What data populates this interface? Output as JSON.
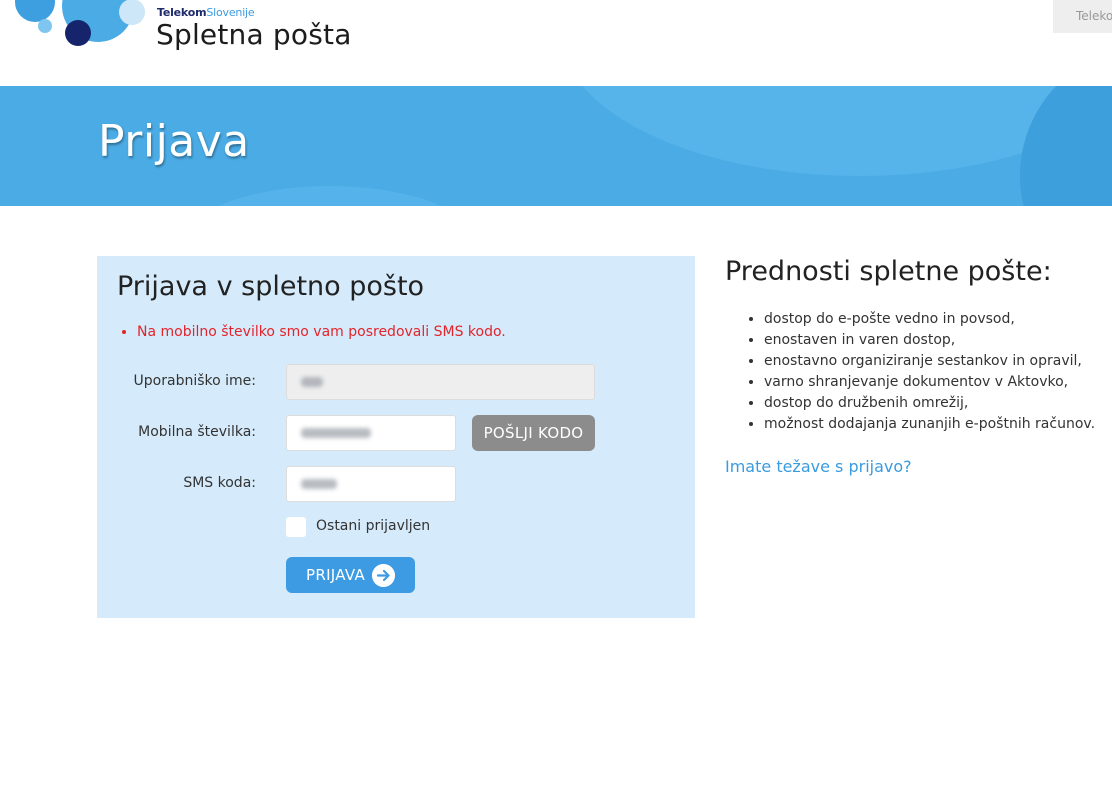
{
  "header": {
    "brand_primary": "Telekom",
    "brand_secondary": "Slovenije",
    "product_name": "Spletna pošta",
    "top_tab_label": "Telekom"
  },
  "banner": {
    "title": "Prijava"
  },
  "login_form": {
    "title": "Prijava v spletno pošto",
    "error_message": "Na mobilno številko smo vam posredovali SMS kodo.",
    "username_label": "Uporabniško ime:",
    "mobile_label": "Mobilna številka:",
    "send_code_label": "POŠLJI KODO",
    "sms_code_label": "SMS koda:",
    "remember_label": "Ostani prijavljen",
    "remember_checked": false,
    "submit_label": "PRIJAVA"
  },
  "benefits": {
    "title": "Prednosti spletne pošte:",
    "items": [
      "dostop do e-pošte vedno in povsod,",
      "enostaven in varen dostop,",
      "enostavno organiziranje sestankov in opravil,",
      "varno shranjevanje dokumentov v Aktovko,",
      "dostop do družbenih omrežij,",
      "možnost dodajanja zunanjih e-poštnih računov."
    ],
    "help_link": "Imate težave s prijavo?"
  },
  "colors": {
    "banner": "#4aabe5",
    "panel": "#d5ebfb",
    "error": "#e3242b",
    "link": "#3a9be0",
    "primary_button": "#3d9be3",
    "secondary_button": "#8c8c8c"
  }
}
